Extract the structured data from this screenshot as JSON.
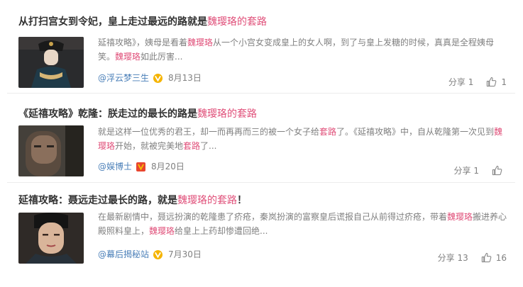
{
  "colors": {
    "accent": "#e0507a",
    "author": "#4a7fb8",
    "muted": "#808080",
    "title": "#333333"
  },
  "articles": [
    {
      "title_prefix": "从打扫宫女到令妃，皇上走过最远的路就是",
      "title_hl": "魏璎珞的套路",
      "title_suffix": "",
      "body": [
        {
          "t": "延禧攻略》，姨母是看着"
        },
        {
          "t": "魏璎珞",
          "hl": true
        },
        {
          "t": "从一个小宫女变成皇上的女人啊，到了与皇上发糖的时候，真真是全程姨母笑。"
        },
        {
          "t": "魏璎珞",
          "hl": true
        },
        {
          "t": "如此厉害..."
        }
      ],
      "author": "@浮云梦三生",
      "badge": "gold-v-badge",
      "date": "8月13日",
      "share": "分享 1",
      "likes": "1"
    },
    {
      "title_prefix": "《延禧攻略》乾隆：朕走过的最长的路是",
      "title_hl": "魏璎珞的套路",
      "title_suffix": "",
      "body": [
        {
          "t": "就是这样一位优秀的君王，却一而再再而三的被一个女子给"
        },
        {
          "t": "套路",
          "hl": true
        },
        {
          "t": "了。《延禧攻略》中，自从乾隆第一次见到"
        },
        {
          "t": "魏璎珞",
          "hl": true
        },
        {
          "t": "开始，就被完美地"
        },
        {
          "t": "套路",
          "hl": true
        },
        {
          "t": "了..."
        }
      ],
      "author": "@娱博士",
      "badge": "red-v-badge",
      "date": "8月20日",
      "share": "分享 1",
      "likes": ""
    },
    {
      "title_prefix": "延禧攻略：聂远走过最长的路，就是",
      "title_hl": "魏璎珞的套路",
      "title_suffix": "！",
      "body": [
        {
          "t": "在最新剧情中，聂远扮演的乾隆患了疥疮，秦岚扮演的富察皇后谎报自己从前得过疥疮，带着"
        },
        {
          "t": "魏璎珞",
          "hl": true
        },
        {
          "t": "搬进养心殿照料皇上，"
        },
        {
          "t": "魏璎珞",
          "hl": true
        },
        {
          "t": "给皇上上药却惨遭回绝..."
        }
      ],
      "author": "@幕后揭秘站",
      "badge": "gold-v-badge",
      "date": "7月30日",
      "share": "分享 13",
      "likes": "16"
    }
  ]
}
